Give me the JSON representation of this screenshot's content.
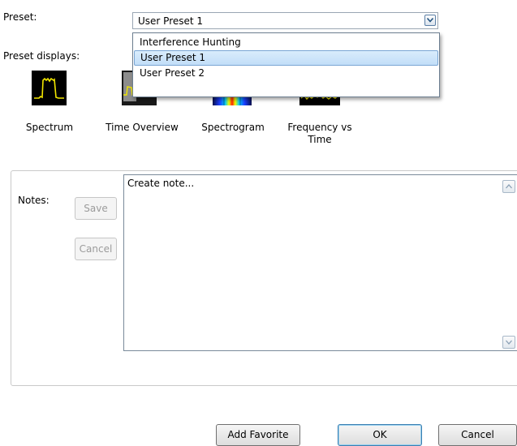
{
  "preset": {
    "label": "Preset:",
    "selected": "User Preset 1",
    "options": [
      "Interference Hunting",
      "User Preset 1",
      "User Preset 2"
    ]
  },
  "displays": {
    "label": "Preset displays:",
    "items": [
      {
        "caption": "Spectrum",
        "icon": "spectrum-icon"
      },
      {
        "caption": "Time Overview",
        "icon": "time-overview-icon"
      },
      {
        "caption": "Spectrogram",
        "icon": "spectrogram-icon"
      },
      {
        "caption": "Frequency vs\nTime",
        "icon": "frequency-vs-time-icon"
      }
    ]
  },
  "notes": {
    "label": "Notes:",
    "save_label": "Save",
    "cancel_label": "Cancel",
    "value": "Create note..."
  },
  "footer": {
    "add_favorite_label": "Add Favorite",
    "ok_label": "OK",
    "cancel_label": "Cancel"
  },
  "colors": {
    "trace": "#f2e600",
    "selection": "#c7e1f9",
    "default_button_border": "#3c7fb1"
  }
}
